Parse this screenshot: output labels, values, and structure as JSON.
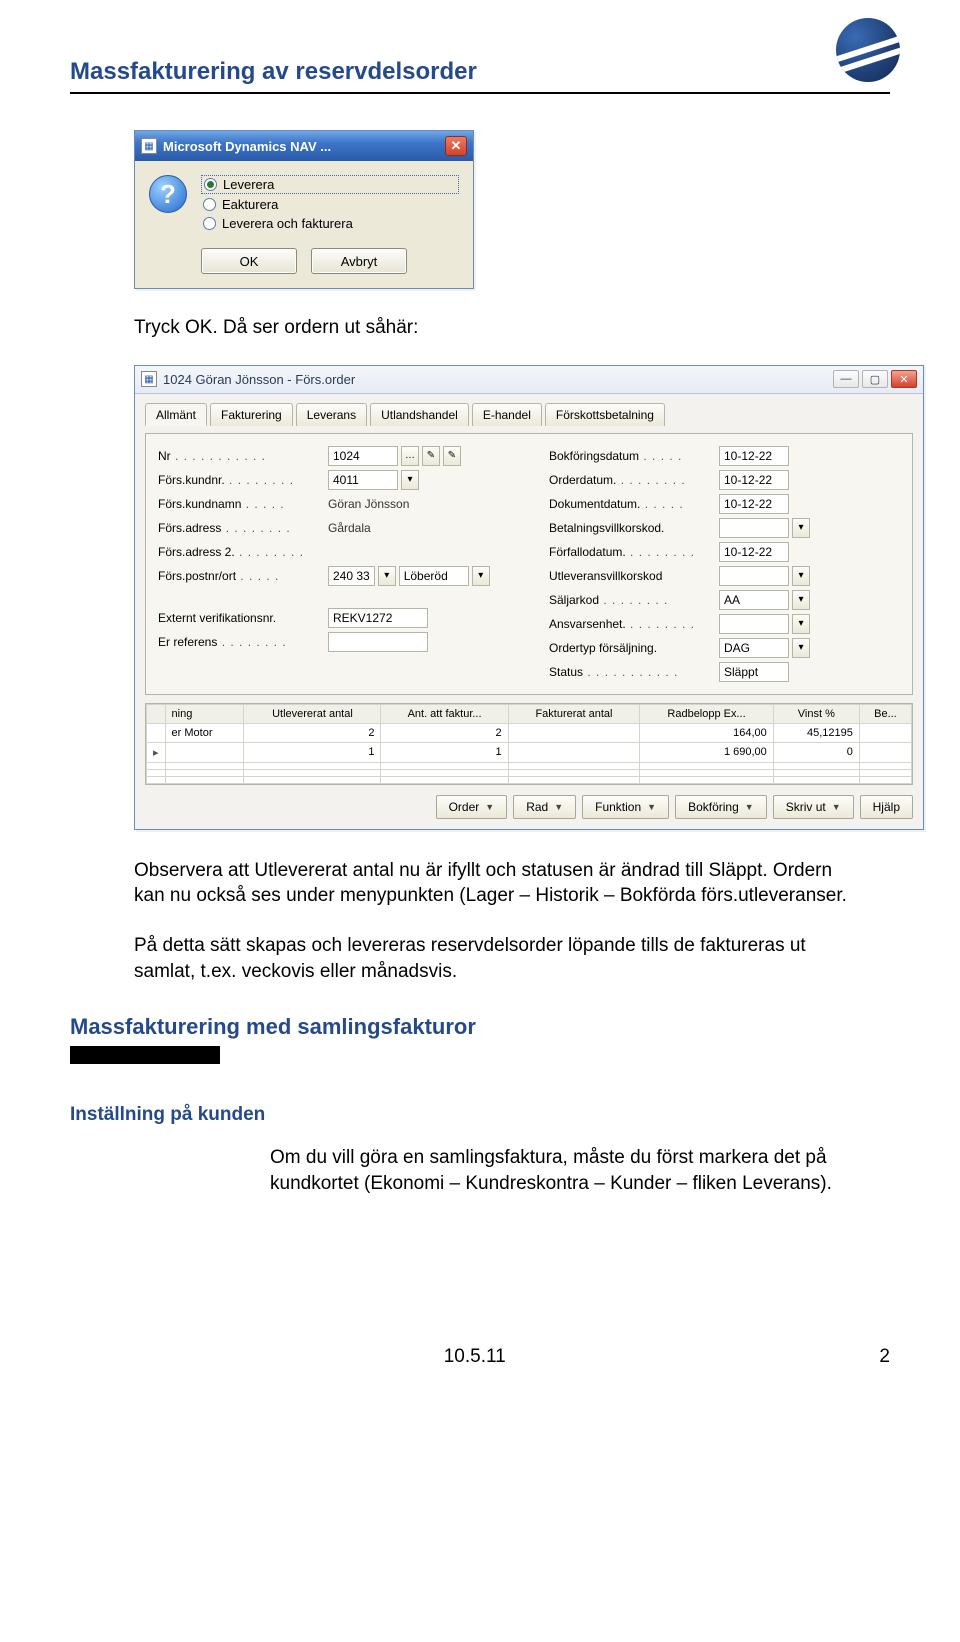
{
  "page": {
    "title": "Massfakturering av reservdelsorder",
    "footer_date": "10.5.11",
    "footer_page": "2"
  },
  "dialog1": {
    "title": "Microsoft Dynamics NAV ...",
    "options": {
      "leverera": "Leverera",
      "fakturera": "Eakturera",
      "lev_fakt": "Leverera och fakturera"
    },
    "ok": "OK",
    "cancel": "Avbryt"
  },
  "text": {
    "p1": "Tryck OK. Då ser ordern ut såhär:",
    "p2": "Observera att Utlevererat antal nu är ifyllt och statusen är ändrad till Släppt. Ordern kan nu också ses under menypunkten (Lager – Historik – Bokförda förs.utleveranser.",
    "p3": "På detta sätt skapas och levereras reservdelsorder löpande tills de faktureras ut samlat, t.ex. veckovis eller månadsvis."
  },
  "order": {
    "title": "1024 Göran Jönsson - Förs.order",
    "tabs": [
      "Allmänt",
      "Fakturering",
      "Leverans",
      "Utlandshandel",
      "E-handel",
      "Förskottsbetalning"
    ],
    "active_tab": 0,
    "left": {
      "nr_label": "Nr",
      "nr_value": "1024",
      "kundnr_label": "Förs.kundnr.",
      "kundnr_value": "4011",
      "kundnamn_label": "Förs.kundnamn",
      "kundnamn_value": "Göran Jönsson",
      "adress_label": "Förs.adress",
      "adress_value": "Gårdala",
      "adress2_label": "Förs.adress 2.",
      "adress2_value": "",
      "postnr_label": "Förs.postnr/ort",
      "postnr_value": "240 33",
      "ort_value": "Löberöd",
      "extver_label": "Externt verifikationsnr.",
      "extver_value": "REKV1272",
      "erref_label": "Er referens",
      "erref_value": ""
    },
    "right": {
      "bokf_label": "Bokföringsdatum",
      "bokf_value": "10-12-22",
      "orderd_label": "Orderdatum.",
      "orderd_value": "10-12-22",
      "dokd_label": "Dokumentdatum.",
      "dokd_value": "10-12-22",
      "betal_label": "Betalningsvillkorskod.",
      "betal_value": "",
      "forf_label": "Förfallodatum.",
      "forf_value": "10-12-22",
      "utl_label": "Utleveransvillkorskod",
      "utl_value": "",
      "salj_label": "Säljarkod",
      "salj_value": "AA",
      "ansv_label": "Ansvarsenhet.",
      "ansv_value": "",
      "ordertyp_label": "Ordertyp försäljning.",
      "ordertyp_value": "DAG",
      "status_label": "Status",
      "status_value": "Släppt"
    },
    "lines": {
      "headers": [
        "",
        "ning",
        "Utlevererat antal",
        "Ant. att faktur...",
        "Fakturerat antal",
        "Radbelopp Ex...",
        "Vinst %",
        "Be..."
      ],
      "rows": [
        {
          "mark": "",
          "desc": "er Motor",
          "utlev": "2",
          "antfakt": "2",
          "fakt": "",
          "belopp": "164,00",
          "vinst": "45,12195",
          "be": ""
        },
        {
          "mark": "▸",
          "desc": "",
          "utlev": "1",
          "antfakt": "1",
          "fakt": "",
          "belopp": "1 690,00",
          "vinst": "0",
          "be": ""
        }
      ]
    },
    "buttons": [
      "Order",
      "Rad",
      "Funktion",
      "Bokföring",
      "Skriv ut",
      "Hjälp"
    ]
  },
  "section2": {
    "heading": "Massfakturering med samlingsfakturor",
    "sub": "Inställning på kunden",
    "body": "Om du vill göra en samlingsfaktura, måste du först markera det på kundkortet (Ekonomi – Kundreskontra – Kunder – fliken Leverans)."
  }
}
